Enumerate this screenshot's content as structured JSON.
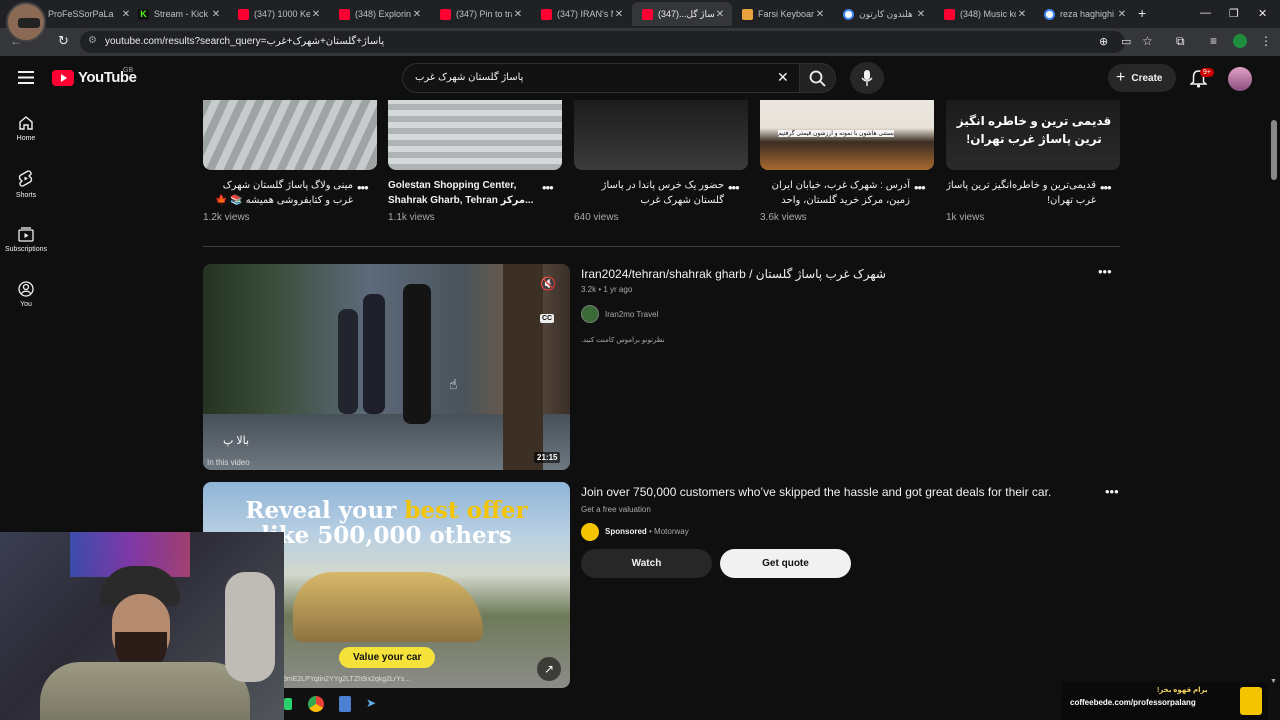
{
  "browser": {
    "tabs": [
      {
        "title": "ProFeSSorPaLa",
        "icon": "avatar-icon"
      },
      {
        "title": "Stream - Kick D",
        "icon": "kick-icon"
      },
      {
        "title": "(347) 1000 Keb",
        "icon": "youtube-icon"
      },
      {
        "title": "(348) Exploring",
        "icon": "youtube-icon"
      },
      {
        "title": "(347) Pin to tra",
        "icon": "youtube-icon"
      },
      {
        "title": "(347) IRAN's M",
        "icon": "youtube-icon"
      },
      {
        "title": "پاساژ گل...(347)",
        "icon": "youtube-icon",
        "active": true
      },
      {
        "title": "Farsi Keyboard",
        "icon": "page-icon"
      },
      {
        "title": "هلندون کارتون",
        "icon": "google-icon"
      },
      {
        "title": "(348) Music kor",
        "icon": "youtube-icon"
      },
      {
        "title": "reza haghighi",
        "icon": "google-icon"
      }
    ],
    "new_tab": "+",
    "url": "youtube.com/results?search_query=پاساژ+گلستان+شهرک+غرب"
  },
  "youtube": {
    "logo_text": "YouTube",
    "region": "GB",
    "search_value": "پاساژ گلستان شهرک غرب",
    "create_label": "Create",
    "notifications_badge": "9+",
    "sidebar": [
      {
        "label": "Home",
        "icon": "home-icon"
      },
      {
        "label": "Shorts",
        "icon": "shorts-icon"
      },
      {
        "label": "Subscriptions",
        "icon": "subscriptions-icon"
      },
      {
        "label": "You",
        "icon": "you-icon"
      }
    ],
    "shorts": [
      {
        "title": "مینی ولاگ پاساژ گلستان شهرک غرب و کتابفروشی همیشه 📚 🍁 #tehr...",
        "views": "1.2k views",
        "thumb_text": ""
      },
      {
        "title": "Golestan Shopping Center, Shahrak Gharb, Tehran مرکز...",
        "views": "1.1k views",
        "thumb_text": ""
      },
      {
        "title": "حضور یک خرس پاندا در پاساژ گلستان شهرک غرب",
        "views": "640 views",
        "thumb_text": ""
      },
      {
        "title": "آدرس : شهرک غرب، خیابان ایران زمین، مرکز خرید گلستان، واحد ۱۰۴...",
        "views": "3.6k views",
        "thumb_text": "بستنی هاشون با نمونه و ارزشون قیمتی گرفتیم"
      },
      {
        "title": "قدیمی‌ترین و خاطره‌انگیز ترین پاساژ غرب تهران!",
        "views": "1k views",
        "thumb_text": "قدیمی ترین و خاطره انگیز ترین پاساژ غرب تهران!"
      }
    ],
    "video": {
      "title": "Iran2024/tehran/shahrak gharb / شهرک غرب پاساژ گلستان",
      "meta": "3.2k • 1 yr ago",
      "channel": "Iran2mo Travel",
      "description": "نظرتونو براموس کامنت کنید.",
      "duration": "21:15",
      "overlay_text": "بالا پ",
      "in_this_video": "In this video",
      "cc_label": "CC"
    },
    "ad": {
      "title": "Join over 750,000 customers who’ve skipped the hassle and got great deals for their car.",
      "subtitle": "Get a free valuation",
      "sponsored": "Sponsored",
      "advertiser": "Motorway",
      "headline_part1": "Reveal your ",
      "headline_highlight": "best offer",
      "headline_part2": "like 500,000 others",
      "cta_overlay": "Value your car",
      "watch_label": "Watch",
      "quote_label": "Get quote",
      "link_text": "9mE2LPYqtin2YYg2LTZh9ix2qkg2LrYs..."
    }
  },
  "overlay": {
    "coffee_text_top": "برام قهوه بخر!",
    "coffee_url": "coffeebede.com/professorpalang"
  },
  "colors": {
    "yt_red": "#ff0033",
    "background": "#0f0f0f",
    "ad_yellow": "#f5c400"
  }
}
